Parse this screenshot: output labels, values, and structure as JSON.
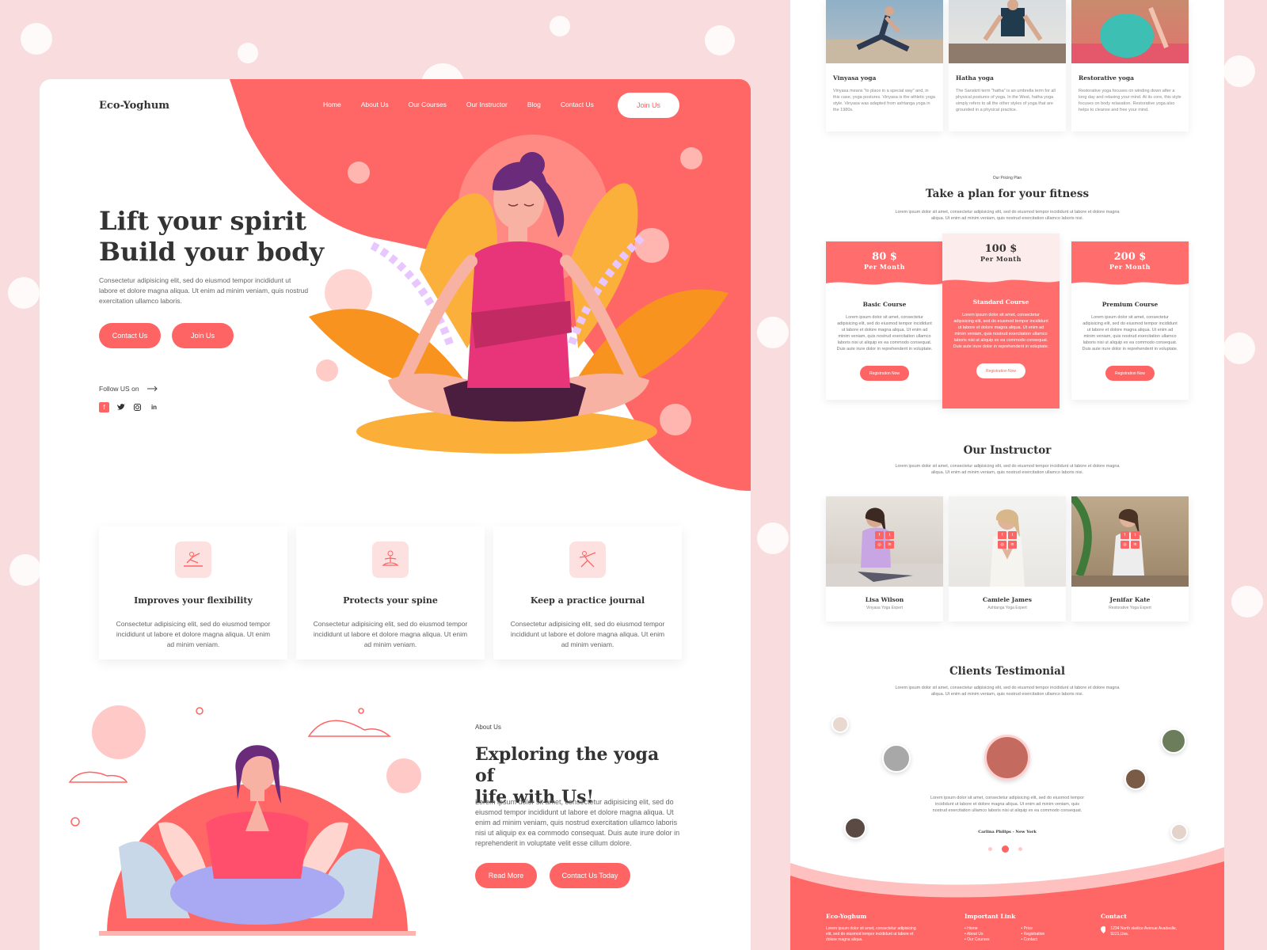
{
  "left": {
    "logo": "Eco-Yoghum",
    "nav": [
      "Home",
      "About Us",
      "Our Courses",
      "Our Instructor",
      "Blog",
      "Contact Us"
    ],
    "join_button": "Join Us",
    "hero": {
      "title_line1": "Lift your spirit",
      "title_line2": "Build your body",
      "text": "Consectetur adipisicing elit, sed do eiusmod tempor incididunt ut labore et dolore magna aliqua. Ut enim ad minim veniam, quis nostrud exercitation ullamco laboris.",
      "contact_button": "Contact Us",
      "join_button": "Join Us",
      "follow_label": "Follow US on",
      "socials": [
        "f",
        "t",
        "ig",
        "in"
      ]
    },
    "features": [
      {
        "title": "Improves your flexibility",
        "text": "Consectetur adipisicing elit, sed do eiusmod tempor incididunt ut labore et dolore magna aliqua. Ut enim ad minim veniam."
      },
      {
        "title": "Protects your spine",
        "text": "Consectetur adipisicing elit, sed do eiusmod tempor incididunt ut labore et dolore magna aliqua. Ut enim ad minim veniam."
      },
      {
        "title": "Keep a practice journal",
        "text": "Consectetur adipisicing elit, sed do eiusmod tempor incididunt ut labore et dolore magna aliqua. Ut enim ad minim veniam."
      }
    ],
    "about": {
      "kicker": "About Us",
      "title_line1": "Exploring the yoga of",
      "title_line2": "life with Us!",
      "text": "Lorem ipsum dolor sit amet, consectetur adipisicing elit, sed do eiusmod tempor incididunt ut labore et dolore magna aliqua. Ut enim ad minim veniam, quis nostrud exercitation ullamco laboris nisi ut aliquip ex ea commodo consequat. Duis aute irure dolor in reprehenderit in voluptate velit esse cillum dolore.",
      "read_more": "Read More",
      "contact_today": "Contact Us Today"
    }
  },
  "right": {
    "yoga_types": [
      {
        "title": "Vinyasa yoga",
        "text": "Vinyasa means \"to place in a special way\" and, in this case, yoga postures. Vinyasa is the athletic yoga style. Vinyasa was adapted from ashtanga yoga in the 1980s."
      },
      {
        "title": "Hatha yoga",
        "text": "The Sanskrit term \"hatha\" is an umbrella term for all physical postures of yoga. In the West, hatha yoga simply refers to all the other styles of yoga that are grounded in a physical practice."
      },
      {
        "title": "Restorative yoga",
        "text": "Restorative yoga focuses on winding down after a long day and relaxing your mind. At its core, this style focuses on body relaxation. Restorative yoga also helps to cleanse and free your mind."
      }
    ],
    "pricing": {
      "kicker": "Our Pricing Plan",
      "title": "Take a plan for your fitness",
      "text": "Lorem ipsum dolor sit amet, consectetur adipisicing elit, sed do eiusmod tempor incididunt ut labore et dolore magna aliqua. Ut enim ad minim veniam, quis nostrud exercitation ullamco laboris nisi.",
      "plans": [
        {
          "price": "80 $",
          "per": "Per Month",
          "name": "Basic Course",
          "text": "Lorem ipsum dolor sit amet, consectetur adipisicing elit, sed do eiusmod tempor incididunt ut labore et dolore magna aliqua. Ut enim ad minim veniam, quis nostrud exercitation ullamco laboris nisi ut aliquip ex ea commodo consequat. Duis aute irure dolor in reprehenderit in voluptate.",
          "button": "Registration Now"
        },
        {
          "price": "100 $",
          "per": "Per Month",
          "name": "Standard Course",
          "text": "Lorem ipsum dolor sit amet, consectetur adipisicing elit, sed do eiusmod tempor incididunt ut labore et dolore magna aliqua. Ut enim ad minim veniam, quis nostrud exercitation ullamco laboris nisi ut aliquip ex ea commodo consequat. Duis aute irure dolor in reprehenderit in voluptate.",
          "button": "Registration Now"
        },
        {
          "price": "200 $",
          "per": "Per Month",
          "name": "Premium Course",
          "text": "Lorem ipsum dolor sit amet, consectetur adipisicing elit, sed do eiusmod tempor incididunt ut labore et dolore magna aliqua. Ut enim ad minim veniam, quis nostrud exercitation ullamco laboris nisi ut aliquip ex ea commodo consequat. Duis aute irure dolor in reprehenderit in voluptate.",
          "button": "Registration Now"
        }
      ]
    },
    "instructors": {
      "title": "Our Instructor",
      "text": "Lorem ipsum dolor sit amet, consectetur adipisicing elit, sed do eiusmod tempor incididunt ut labore et dolore magna aliqua. Ut enim ad minim veniam, quis nostrud exercitation ullamco laboris nisi.",
      "people": [
        {
          "name": "Lisa Wilson",
          "role": "Vinyasa Yoga Expert"
        },
        {
          "name": "Camiele James",
          "role": "Ashtanga Yoga Expert"
        },
        {
          "name": "Jenifar Kate",
          "role": "Restorative Yoga Expert"
        }
      ]
    },
    "testimonial": {
      "title": "Clients Testimonial",
      "text": "Lorem ipsum dolor sit amet, consectetur adipisicing elit, sed do eiusmod tempor incididunt ut labore et dolore magna aliqua. Ut enim ad minim veniam, quis nostrud exercitation ullamco laboris nisi.",
      "quote": "Lorem ipsum dolor sit amet, consectetur adipisicing elit, sed do eiusmod tempor incididunt ut labore et dolore magna aliqua. Ut enim ad minim veniam, quis nostrud exercitation ullamco laboris nisi ut aliquip ex ea commodo consequat.",
      "author": "Carlina Philips - New York"
    },
    "footer": {
      "brand": "Eco-Yoghum",
      "brand_text": "Lorem ipsum dolor sit amet, consectetur adipisicing elit, sed do eiusmod tempor incididunt ut labore et dolore magna aliqua.",
      "links_title": "Important Link",
      "links_col1": [
        "Home",
        "About Us",
        "Our Courses"
      ],
      "links_col2": [
        "Price",
        "Registration",
        "Contact"
      ],
      "contact_title": "Contact",
      "address": "1234 North skelice Avenue Avadeulle, 9221,Usa."
    }
  }
}
